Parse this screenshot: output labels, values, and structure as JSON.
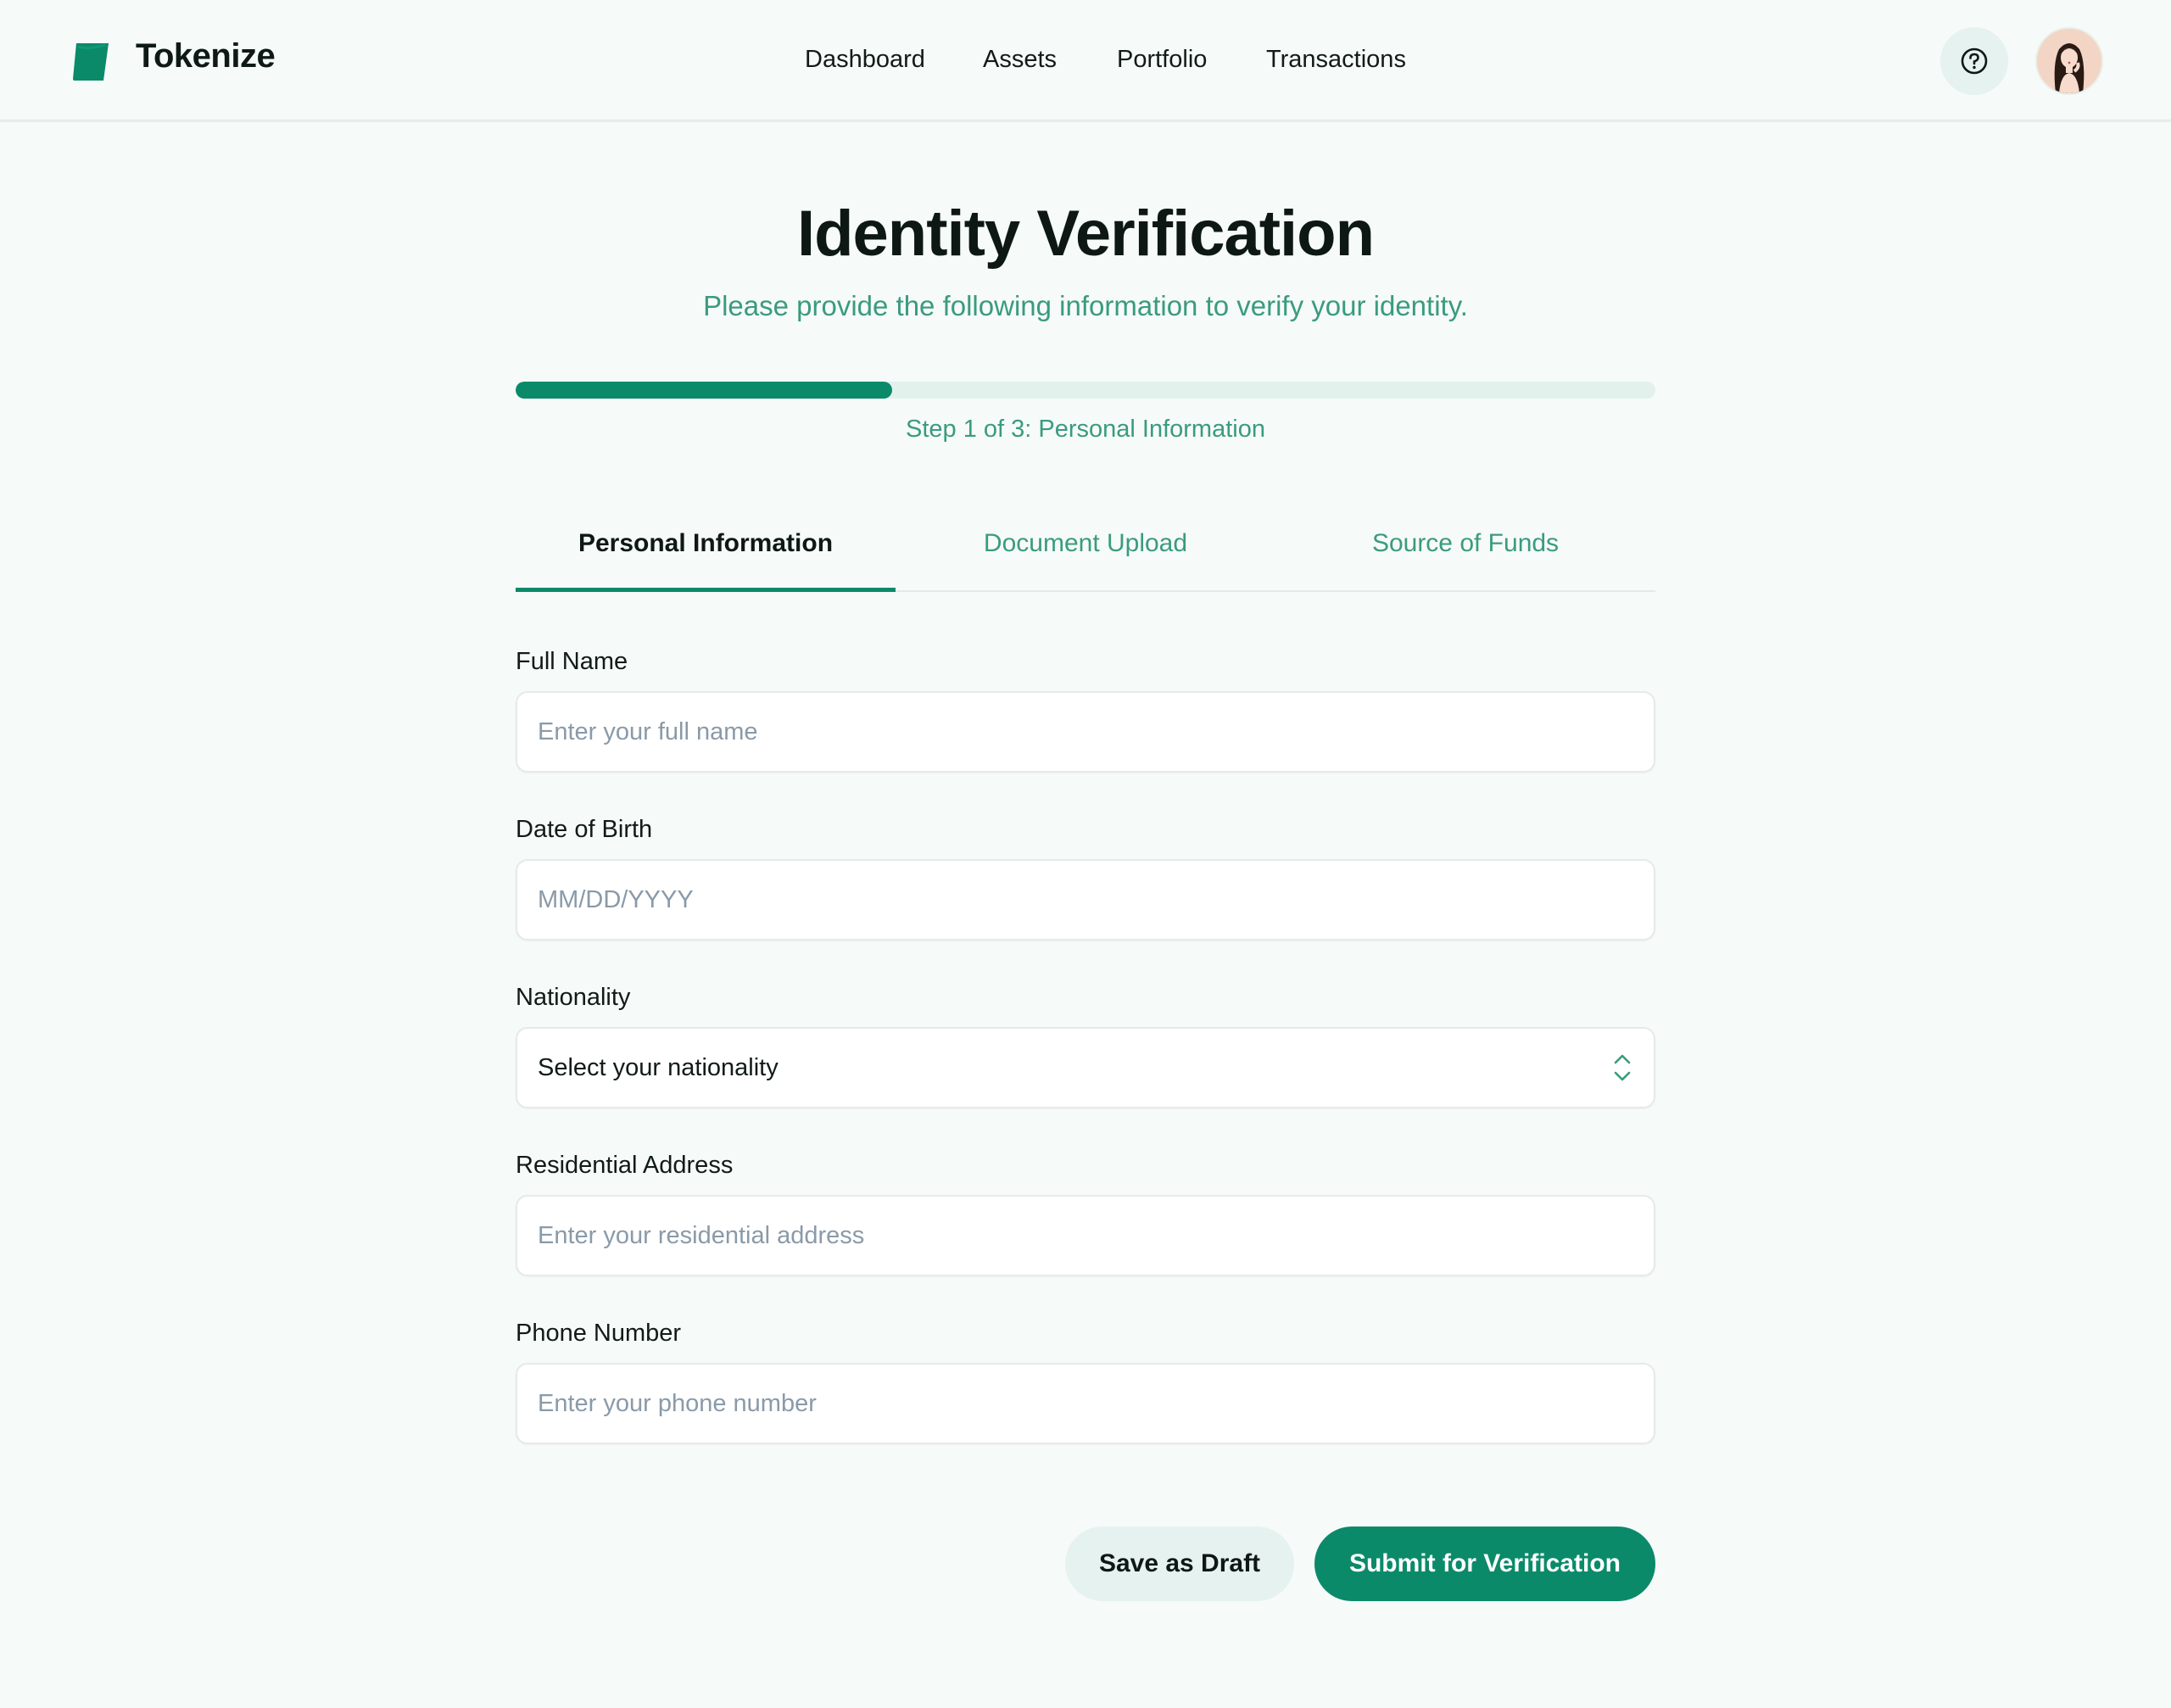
{
  "app": {
    "brand": "Tokenize",
    "accent_color": "#0b8a6a",
    "logo_icon": "tokenize-logo"
  },
  "nav": {
    "items": [
      {
        "label": "Dashboard"
      },
      {
        "label": "Assets"
      },
      {
        "label": "Portfolio"
      },
      {
        "label": "Transactions"
      }
    ],
    "help_icon": "question-circle-icon",
    "avatar_icon": "user-avatar"
  },
  "page": {
    "title": "Identity Verification",
    "subtitle": "Please provide the following information to verify your identity."
  },
  "progress": {
    "fraction": 0.33,
    "step_text": "Step 1 of 3: Personal Information"
  },
  "tabs": [
    {
      "label": "Personal Information",
      "active": true
    },
    {
      "label": "Document Upload",
      "active": false
    },
    {
      "label": "Source of Funds",
      "active": false
    }
  ],
  "form": {
    "full_name": {
      "label": "Full Name",
      "placeholder": "Enter your full name",
      "value": ""
    },
    "dob": {
      "label": "Date of Birth",
      "placeholder": "MM/DD/YYYY",
      "value": ""
    },
    "nationality": {
      "label": "Nationality",
      "selected": "Select your nationality"
    },
    "address": {
      "label": "Residential Address",
      "placeholder": "Enter your residential address",
      "value": ""
    },
    "phone": {
      "label": "Phone Number",
      "placeholder": "Enter your phone number",
      "value": ""
    }
  },
  "actions": {
    "save_draft": "Save as Draft",
    "submit": "Submit for Verification"
  }
}
